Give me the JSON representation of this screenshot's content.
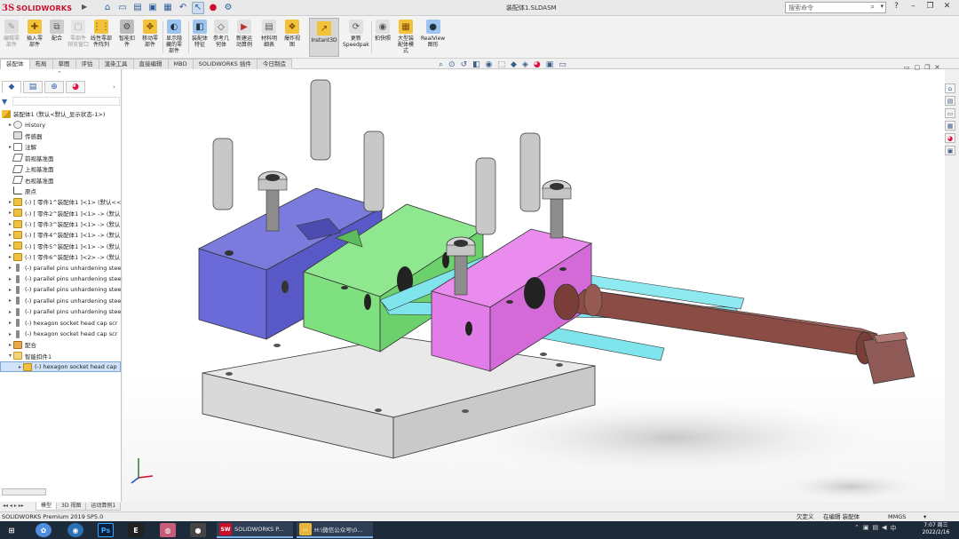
{
  "app": {
    "logo_ds": "3S",
    "logo_text": "SOLIDWORKS",
    "document_title": "装配体1.SLDASM",
    "search_placeholder": "搜索命令"
  },
  "quick_access": [
    "home-icon",
    "new-icon",
    "open-icon",
    "save-icon",
    "print-icon",
    "undo-icon",
    "select-icon",
    "rebuild-icon",
    "options-icon"
  ],
  "window_controls": [
    "help-icon",
    "minimize-icon",
    "restore-icon",
    "close-icon"
  ],
  "ribbon": {
    "buttons": [
      {
        "label": "编辑零\n部件",
        "dim": true
      },
      {
        "label": "插入零\n部件",
        "dim": false
      },
      {
        "label": "配合",
        "dim": false
      },
      {
        "label": "零部件\n预览窗口",
        "dim": true
      },
      {
        "label": "线性零部\n件阵列",
        "dim": false
      },
      {
        "label": "智能扣\n件",
        "dim": false
      },
      {
        "label": "移动零\n部件",
        "dim": false
      },
      {
        "label": "显示隐\n藏的零\n部件",
        "dim": false
      },
      {
        "label": "装配体\n特征",
        "dim": false
      },
      {
        "label": "参考几\n何体",
        "dim": false
      },
      {
        "label": "新建运\n动算例",
        "dim": false
      },
      {
        "label": "材料明\n细表",
        "dim": false
      },
      {
        "label": "爆炸视\n图",
        "dim": false
      },
      {
        "label": "Instant3D",
        "dim": false
      },
      {
        "label": "更新\nSpeedpak",
        "dim": false
      },
      {
        "label": "拍快照",
        "dim": false
      },
      {
        "label": "大型装\n配体模\n式",
        "dim": false
      },
      {
        "label": "RealView\n图形",
        "dim": false
      }
    ]
  },
  "tabs": [
    "装配体",
    "布局",
    "草图",
    "评估",
    "渲染工具",
    "直接编辑",
    "MBD",
    "SOLIDWORKS 插件",
    "今日制造"
  ],
  "feature_tree": {
    "root": "装配体1 (默认<默认_显示状态-1>)",
    "items": [
      {
        "label": "History",
        "icon": "history",
        "exp": "▸",
        "lvl": 1
      },
      {
        "label": "传感器",
        "icon": "sensor",
        "exp": "",
        "lvl": 1
      },
      {
        "label": "注解",
        "icon": "note",
        "exp": "▸",
        "lvl": 1
      },
      {
        "label": "前视基准面",
        "icon": "plane",
        "exp": "",
        "lvl": 1
      },
      {
        "label": "上视基准面",
        "icon": "plane",
        "exp": "",
        "lvl": 1
      },
      {
        "label": "右视基准面",
        "icon": "plane",
        "exp": "",
        "lvl": 1
      },
      {
        "label": "原点",
        "icon": "origin",
        "exp": "",
        "lvl": 1
      },
      {
        "label": "(-) [ 零件1^装配体1 ]<1> (默认<<",
        "icon": "part",
        "exp": "▸",
        "lvl": 1
      },
      {
        "label": "(-) [ 零件2^装配体1 ]<1> -> (默认",
        "icon": "part",
        "exp": "▸",
        "lvl": 1
      },
      {
        "label": "(-) [ 零件3^装配体1 ]<1> -> (默认",
        "icon": "part",
        "exp": "▸",
        "lvl": 1
      },
      {
        "label": "(-) [ 零件4^装配体1 ]<1> -> (默认",
        "icon": "part",
        "exp": "▸",
        "lvl": 1
      },
      {
        "label": "(-) [ 零件5^装配体1 ]<1> -> (默认",
        "icon": "part",
        "exp": "▸",
        "lvl": 1
      },
      {
        "label": "(-) [ 零件6^装配体1 ]<2> -> (默认",
        "icon": "part",
        "exp": "▸",
        "lvl": 1
      },
      {
        "label": "(-) parallel pins unhardening stee",
        "icon": "pin",
        "exp": "▸",
        "lvl": 1
      },
      {
        "label": "(-) parallel pins unhardening stee",
        "icon": "pin",
        "exp": "▸",
        "lvl": 1
      },
      {
        "label": "(-) parallel pins unhardening stee",
        "icon": "pin",
        "exp": "▸",
        "lvl": 1
      },
      {
        "label": "(-) parallel pins unhardening stee",
        "icon": "pin",
        "exp": "▸",
        "lvl": 1
      },
      {
        "label": "(-) parallel pins unhardening stee",
        "icon": "pin",
        "exp": "▸",
        "lvl": 1
      },
      {
        "label": "(-) hexagon socket head cap scr",
        "icon": "pin",
        "exp": "▸",
        "lvl": 1
      },
      {
        "label": "(-) hexagon socket head cap scr",
        "icon": "pin",
        "exp": "▸",
        "lvl": 1
      },
      {
        "label": "配合",
        "icon": "mate",
        "exp": "▸",
        "lvl": 1
      },
      {
        "label": "智能扣件1",
        "icon": "folder",
        "exp": "▾",
        "lvl": 1
      },
      {
        "label": "(-) hexagon socket head cap",
        "icon": "part",
        "exp": "▸",
        "lvl": 2,
        "selected": true
      }
    ]
  },
  "bottom_tabs": [
    "模型",
    "3D 视图",
    "运动算例1"
  ],
  "status": {
    "left": "SOLIDWORKS Premium 2019 SP5.0",
    "defined": "欠定义",
    "editing": "在编辑 装配体",
    "units": "MMGS",
    "dd": "▾"
  },
  "taskbar": {
    "apps": [
      {
        "label": "SOLIDWORKS P...",
        "badge": "SW\n2019",
        "color": "#c8102e"
      },
      {
        "label": "H:\\微信公众号\\0...",
        "badge": "",
        "color": "#e8b73a"
      }
    ],
    "clock_time": "7:07 周三",
    "clock_date": "2022/2/16"
  },
  "colors": {
    "block_purple": "#6a6ad8",
    "block_green": "#7fe07f",
    "block_pink": "#e27ce8",
    "rod_cyan": "#7fe4ec",
    "screw_brown": "#8a4c44",
    "base_gray": "#dcdcdc"
  }
}
